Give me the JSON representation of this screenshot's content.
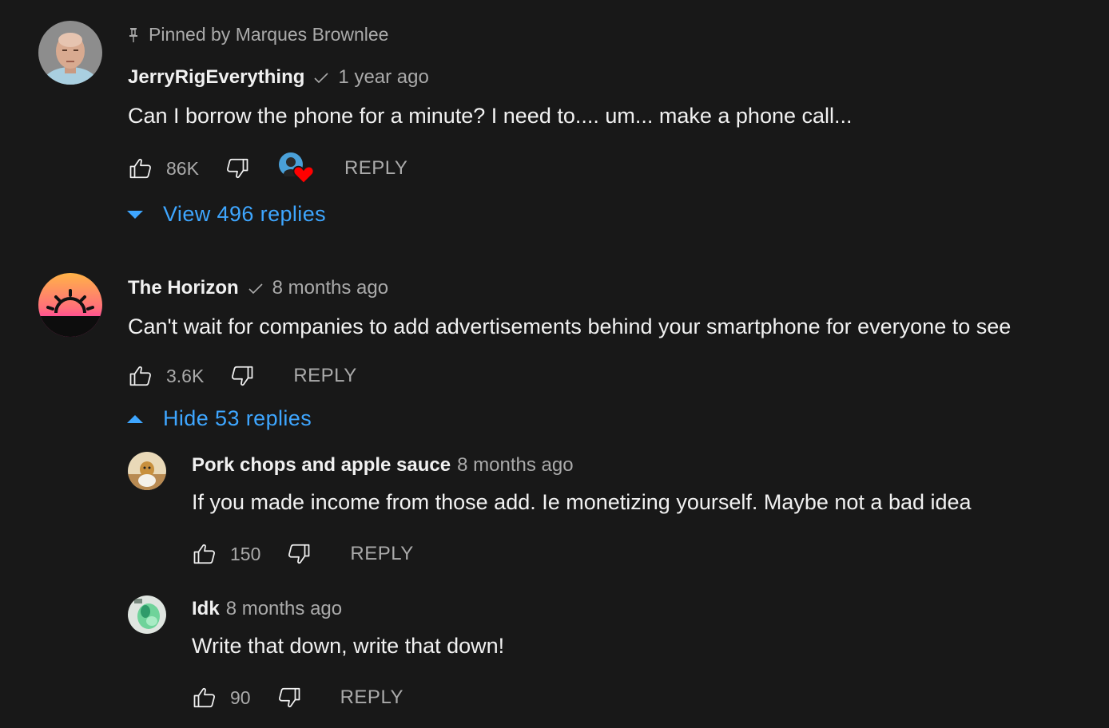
{
  "colors": {
    "background": "#181818",
    "primary_text": "#f1f1f1",
    "secondary_text": "#aaaaaa",
    "link_blue": "#3ea6ff",
    "heart_red": "#ff0000"
  },
  "comments": [
    {
      "pinned_label": "Pinned by Marques Brownlee",
      "author": "JerryRigEverything",
      "verified": true,
      "time": "1 year ago",
      "text": "Can I borrow the phone for a minute? I need to.... um... make a phone call...",
      "likes": "86K",
      "creator_heart": true,
      "reply_label": "REPLY",
      "replies_toggle": "View 496 replies",
      "icons": [
        "pin-icon",
        "check-icon",
        "thumbs-up-icon",
        "thumbs-down-icon",
        "creator-heart-icon",
        "caret-down-icon"
      ]
    },
    {
      "author": "The Horizon",
      "verified": true,
      "time": "8 months ago",
      "text": "Can't wait for companies to add advertisements behind your smartphone for everyone to see",
      "likes": "3.6K",
      "reply_label": "REPLY",
      "replies_toggle": "Hide 53 replies",
      "icons": [
        "sunrise-avatar",
        "check-icon",
        "thumbs-up-icon",
        "thumbs-down-icon",
        "caret-up-icon"
      ],
      "replies": [
        {
          "author": "Pork chops and apple sauce",
          "time": "8 months ago",
          "text": "If you made income from those add. Ie monetizing yourself. Maybe not a bad idea",
          "likes": "150",
          "reply_label": "REPLY"
        },
        {
          "author": "Idk",
          "time": "8 months ago",
          "text": "Write that down, write that down!",
          "likes": "90",
          "reply_label": "REPLY"
        }
      ]
    }
  ]
}
